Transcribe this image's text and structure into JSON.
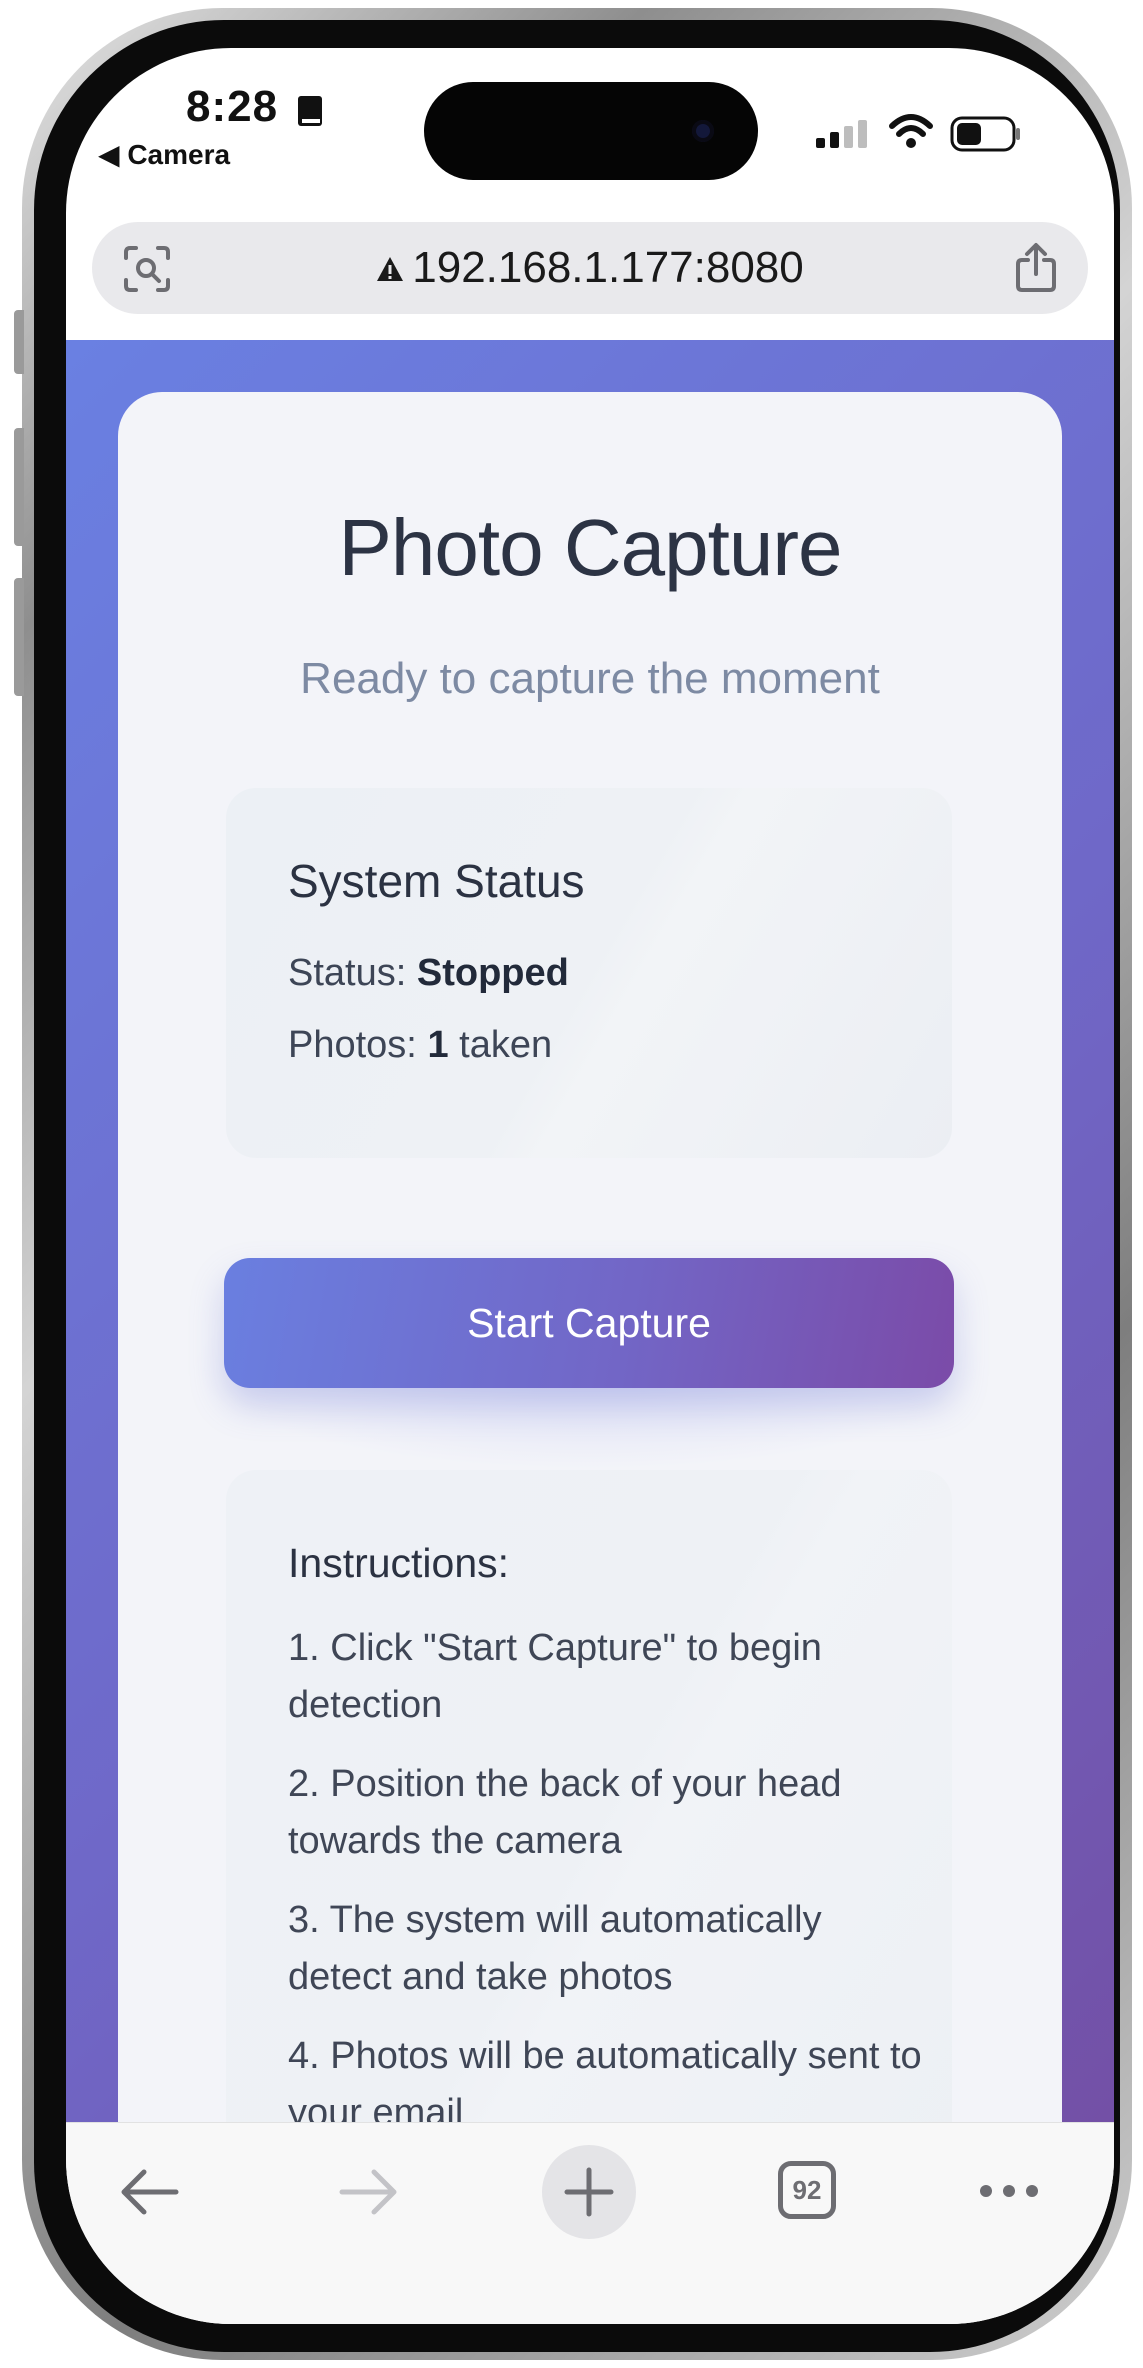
{
  "status_bar": {
    "time": "8:28",
    "back_label": "◀ Camera"
  },
  "browser": {
    "url": "192.168.1.177:8080",
    "tab_count": "92"
  },
  "page": {
    "title": "Photo Capture",
    "subtitle": "Ready to capture the moment",
    "system_status": {
      "heading": "System Status",
      "status_label": "Status:",
      "status_value": "Stopped",
      "photos_label": "Photos:",
      "photos_value": "1",
      "photos_suffix": "taken"
    },
    "start_button_label": "Start Capture",
    "instructions": {
      "heading": "Instructions:",
      "items": [
        "1. Click \"Start Capture\" to begin detection",
        "2. Position the back of your head towards the camera",
        "3. The system will automatically detect and take photos",
        "4. Photos will be automatically sent to your email"
      ]
    }
  },
  "colors": {
    "gradient_start": "#6a80e2",
    "gradient_end": "#7350a6",
    "card_bg": "#f3f4f9",
    "title_text": "#2c3344"
  },
  "icons": {
    "lens": "visual-lookup-icon",
    "warning": "warning-triangle-icon",
    "share": "share-icon",
    "back": "arrow-left-icon",
    "forward": "arrow-right-icon",
    "add": "plus-icon",
    "tabs": "tabs-icon",
    "more": "more-dots-icon"
  }
}
